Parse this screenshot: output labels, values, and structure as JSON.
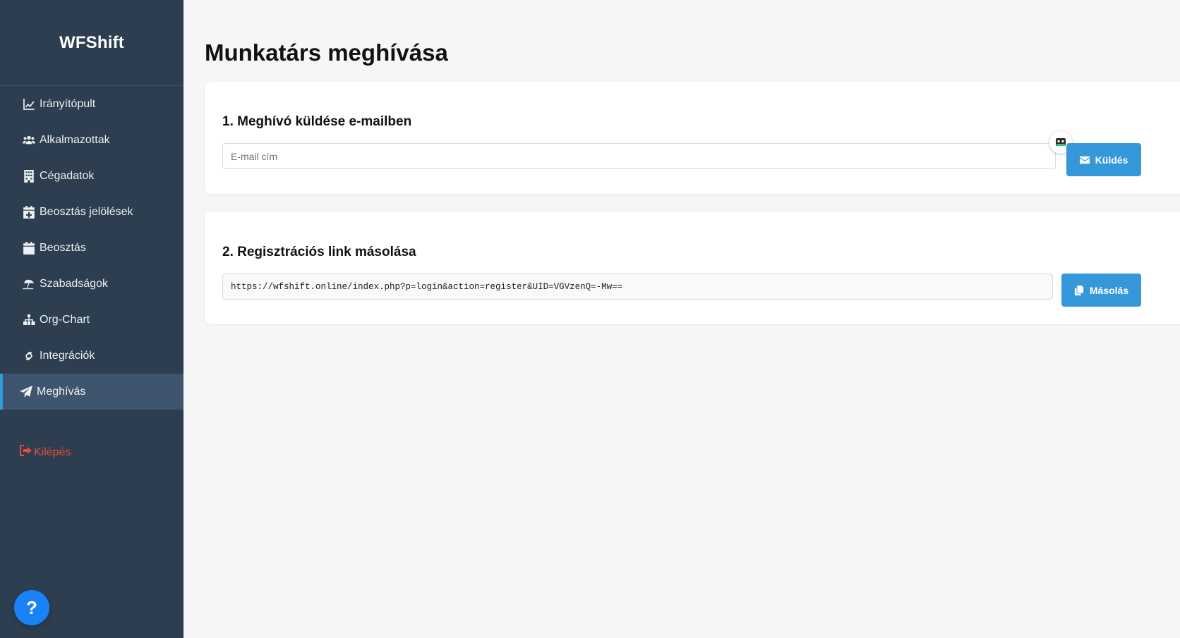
{
  "brand": "WFShift",
  "sidebar": {
    "items": [
      {
        "label": "Irányítópult",
        "icon": "chart-line-icon"
      },
      {
        "label": "Alkalmazottak",
        "icon": "users-icon"
      },
      {
        "label": "Cégadatok",
        "icon": "building-icon"
      },
      {
        "label": "Beosztás jelölések",
        "icon": "calendar-plus-icon"
      },
      {
        "label": "Beosztás",
        "icon": "calendar-icon"
      },
      {
        "label": "Szabadságok",
        "icon": "umbrella-beach-icon"
      },
      {
        "label": "Org-Chart",
        "icon": "sitemap-icon"
      },
      {
        "label": "Integrációk",
        "icon": "link-icon"
      },
      {
        "label": "Meghívás",
        "icon": "paper-plane-icon",
        "active": true
      }
    ],
    "logout_label": "Kilépés",
    "help_label": "?"
  },
  "main": {
    "page_title": "Munkatárs meghívása",
    "email_section": {
      "title": "1. Meghívó küldése e-mailben",
      "input_placeholder": "E-mail cím",
      "input_value": "",
      "send_label": "Küldés"
    },
    "link_section": {
      "title": "2. Regisztrációs link másolása",
      "link": "https://wfshift.online/index.php?p=login&action=register&UID=VGVzenQ=-Mw==",
      "copy_label": "Másolás"
    }
  },
  "colors": {
    "sidebar_bg": "#2c3e50",
    "accent": "#3498db",
    "logout": "#e74c3c",
    "help": "#1a82f7"
  }
}
